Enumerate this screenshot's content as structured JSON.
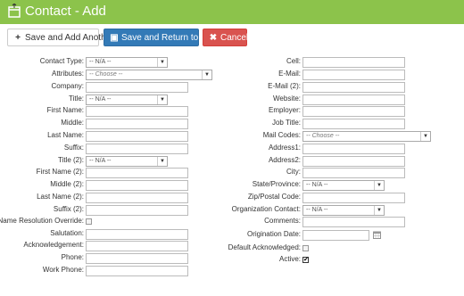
{
  "header": {
    "title": "Contact - Add",
    "bg_color": "#8cc34b",
    "icon": "window-icon"
  },
  "toolbar": {
    "add_another_label": "Save and Add Another",
    "save_return_label": "Save and Return to List",
    "cancel_label": "Cancel",
    "colors": {
      "save": "#337ab7",
      "cancel": "#d9534f"
    }
  },
  "left": {
    "contact_type_label": "Contact Type:",
    "contact_type_value": "-- N/A --",
    "attributes_label": "Attributes:",
    "attributes_value": "-- Choose --",
    "company_label": "Company:",
    "title_label": "Title:",
    "title_value": "-- N/A --",
    "first_name_label": "First Name:",
    "middle_label": "Middle:",
    "last_name_label": "Last Name:",
    "suffix_label": "Suffix:",
    "title2_label": "Title (2):",
    "title2_value": "-- N/A --",
    "first_name2_label": "First Name (2):",
    "middle2_label": "Middle (2):",
    "last_name2_label": "Last Name (2):",
    "suffix2_label": "Suffix (2):",
    "name_resolution_label": "Name Resolution Override:",
    "salutation_label": "Salutation:",
    "acknowledgement_label": "Acknowledgement:",
    "phone_label": "Phone:",
    "work_phone_label": "Work Phone:"
  },
  "right": {
    "cell_label": "Cell:",
    "email_label": "E-Mail:",
    "email2_label": "E-Mail (2):",
    "website_label": "Website:",
    "employer_label": "Employer:",
    "job_title_label": "Job Title:",
    "mail_codes_label": "Mail Codes:",
    "mail_codes_value": "-- Choose --",
    "address1_label": "Address1:",
    "address2_label": "Address2:",
    "city_label": "City:",
    "state_label": "State/Province:",
    "state_value": "-- N/A --",
    "zip_label": "Zip/Postal Code:",
    "org_contact_label": "Organization Contact:",
    "org_contact_value": "-- N/A --",
    "comments_label": "Comments:",
    "origination_date_label": "Origination Date:",
    "default_ack_label": "Default Acknowledged:",
    "active_label": "Active:"
  }
}
